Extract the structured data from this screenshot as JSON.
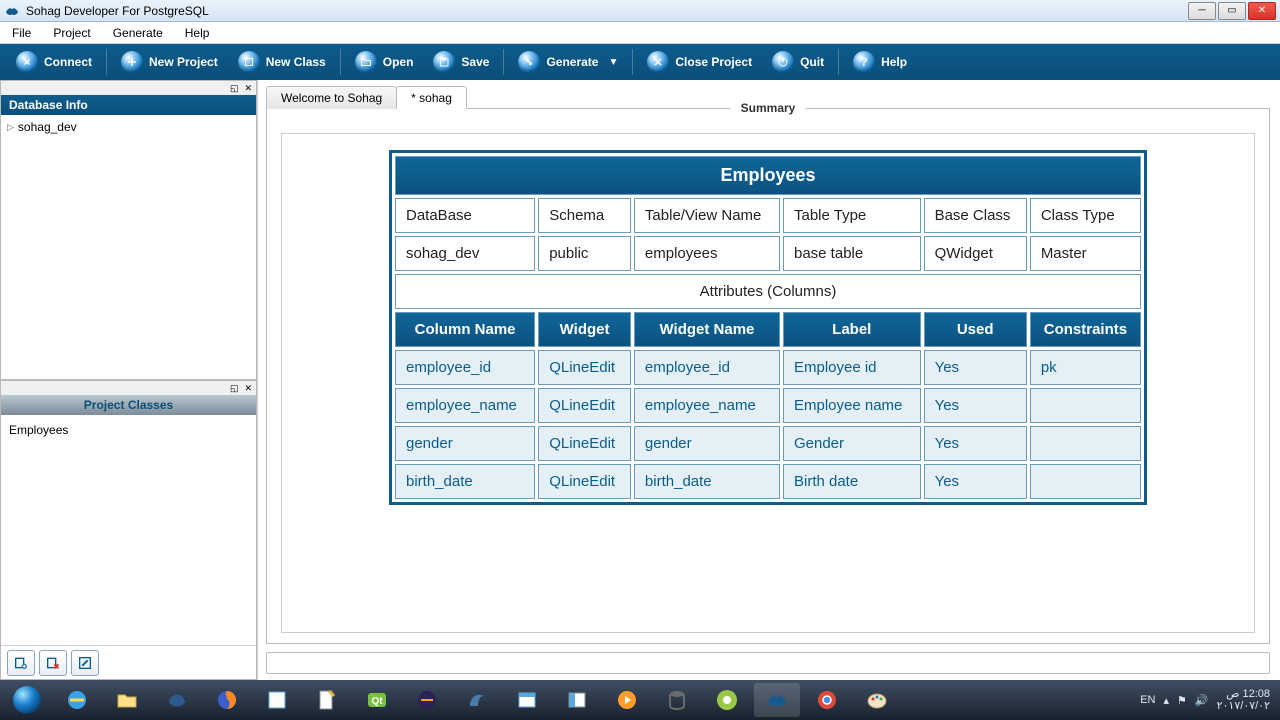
{
  "titlebar": {
    "title": "Sohag Developer For PostgreSQL"
  },
  "menubar": [
    "File",
    "Project",
    "Generate",
    "Help"
  ],
  "toolbar": {
    "connect": "Connect",
    "new_project": "New Project",
    "new_class": "New Class",
    "open": "Open",
    "save": "Save",
    "generate": "Generate",
    "close_project": "Close Project",
    "quit": "Quit",
    "help": "Help"
  },
  "sidebar": {
    "db_info_title": "Database Info",
    "db_tree_root": "sohag_dev",
    "classes_title": "Project Classes",
    "classes": [
      "Employees"
    ]
  },
  "tabs": {
    "welcome": "Welcome to Sohag",
    "current": "* sohag"
  },
  "summary": {
    "label": "Summary",
    "title": "Employees",
    "meta_headers": [
      "DataBase",
      "Schema",
      "Table/View Name",
      "Table Type",
      "Base Class",
      "Class Type"
    ],
    "meta_values": [
      "sohag_dev",
      "public",
      "employees",
      "base table",
      "QWidget",
      "Master"
    ],
    "attr_label": "Attributes (Columns)",
    "col_headers": [
      "Column Name",
      "Widget",
      "Widget Name",
      "Label",
      "Used",
      "Constraints"
    ],
    "rows": [
      {
        "col": "employee_id",
        "widget": "QLineEdit",
        "wname": "employee_id",
        "label": "Employee id",
        "used": "Yes",
        "constr": "pk"
      },
      {
        "col": "employee_name",
        "widget": "QLineEdit",
        "wname": "employee_name",
        "label": "Employee name",
        "used": "Yes",
        "constr": ""
      },
      {
        "col": "gender",
        "widget": "QLineEdit",
        "wname": "gender",
        "label": "Gender",
        "used": "Yes",
        "constr": ""
      },
      {
        "col": "birth_date",
        "widget": "QLineEdit",
        "wname": "birth_date",
        "label": "Birth date",
        "used": "Yes",
        "constr": ""
      }
    ]
  },
  "taskbar": {
    "lang": "EN",
    "time": "12:08 ص",
    "date": "٢٠١٧/٠٧/٠٢"
  }
}
